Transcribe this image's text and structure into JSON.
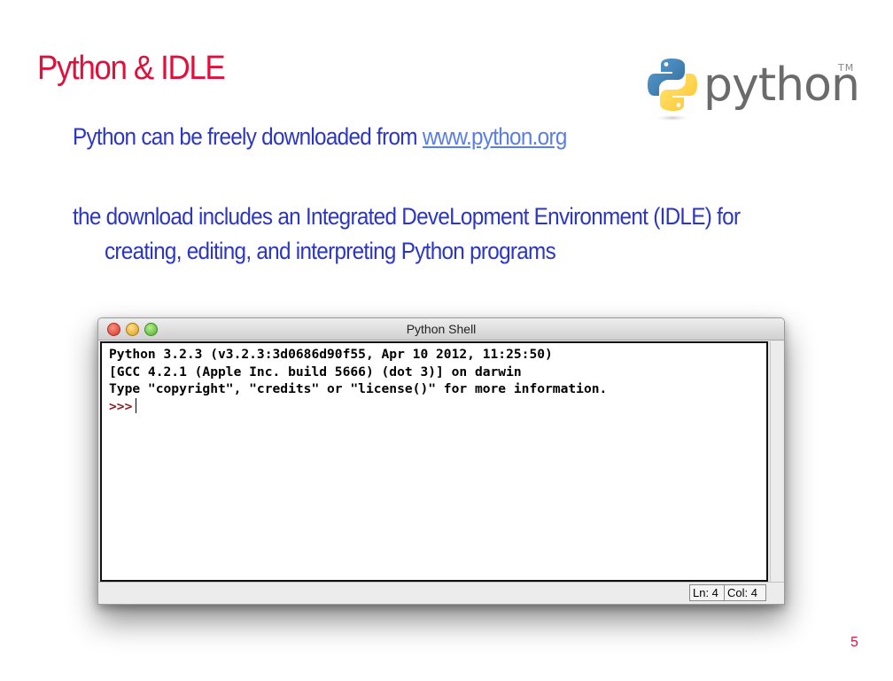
{
  "slide": {
    "title": "Python & IDLE",
    "page_number": "5"
  },
  "logo": {
    "wordmark": "python",
    "tm": "TM"
  },
  "body": {
    "line1_text": "Python can be freely downloaded from ",
    "line1_link": "www.python.org",
    "line2": "the download includes an Integrated DeveLopment Environment (IDLE) for",
    "line2_cont": "creating, editing, and interpreting Python programs"
  },
  "shell": {
    "window_title": "Python Shell",
    "lines": [
      "Python 3.2.3 (v3.2.3:3d0686d90f55, Apr 10 2012, 11:25:50)",
      "[GCC 4.2.1 (Apple Inc. build 5666) (dot 3)] on darwin",
      "Type \"copyright\", \"credits\" or \"license()\" for more information."
    ],
    "prompt": ">>>",
    "status_ln": "Ln: 4",
    "status_col": "Col: 4"
  },
  "colors": {
    "title_red": "#e0103c",
    "body_blue": "#2b36c5",
    "link_blue": "#5b7ee5",
    "prompt_red": "#8b1c1c",
    "python_blue": "#3b73a8",
    "python_yellow": "#f7cd3a"
  }
}
